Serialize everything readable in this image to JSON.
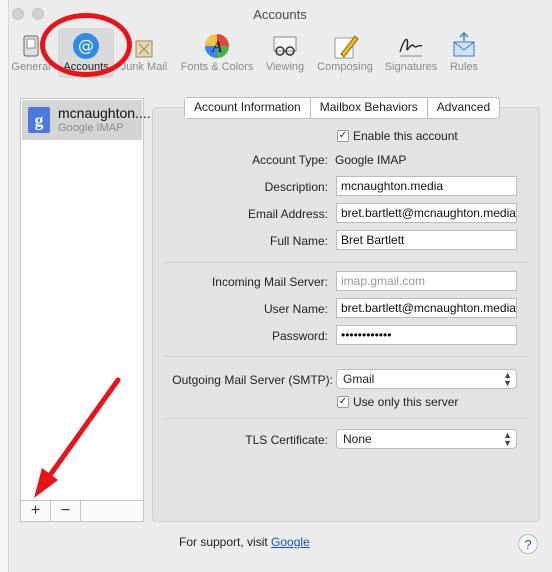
{
  "window": {
    "title": "Accounts"
  },
  "toolbar": {
    "items": [
      {
        "label": "General",
        "icon": "switch-icon"
      },
      {
        "label": "Accounts",
        "icon": "at-sign-icon"
      },
      {
        "label": "Junk Mail",
        "icon": "trash-icon"
      },
      {
        "label": "Fonts & Colors",
        "icon": "color-wheel-icon"
      },
      {
        "label": "Viewing",
        "icon": "glasses-icon"
      },
      {
        "label": "Composing",
        "icon": "pencil-icon"
      },
      {
        "label": "Signatures",
        "icon": "signature-icon"
      },
      {
        "label": "Rules",
        "icon": "envelope-rules-icon"
      }
    ],
    "selected": "Accounts"
  },
  "sidebar": {
    "account": {
      "name": "mcnaughton....",
      "type": "Google IMAP",
      "icon_letter": "g"
    },
    "add_label": "+",
    "remove_label": "−"
  },
  "tabs": [
    "Account Information",
    "Mailbox Behaviors",
    "Advanced"
  ],
  "form": {
    "enable_label": "Enable this account",
    "enable_checked": true,
    "account_type_label": "Account Type:",
    "account_type_value": "Google IMAP",
    "description_label": "Description:",
    "description_value": "mcnaughton.media",
    "email_label": "Email Address:",
    "email_value": "bret.bartlett@mcnaughton.media",
    "fullname_label": "Full Name:",
    "fullname_value": "Bret Bartlett",
    "incoming_label": "Incoming Mail Server:",
    "incoming_placeholder": "imap.gmail.com",
    "username_label": "User Name:",
    "username_value": "bret.bartlett@mcnaughton.media",
    "password_label": "Password:",
    "password_value": "••••••••••••",
    "smtp_label": "Outgoing Mail Server (SMTP):",
    "smtp_value": "Gmail",
    "only_server_label": "Use only this server",
    "only_server_checked": true,
    "tls_label": "TLS Certificate:",
    "tls_value": "None"
  },
  "footer": {
    "support_text": "For support, visit",
    "support_link": "Google",
    "help_label": "?"
  },
  "colors": {
    "annotation_red": "#e8141a",
    "link_blue": "#1a4ccf",
    "google_blue": "#4a7ae0"
  }
}
